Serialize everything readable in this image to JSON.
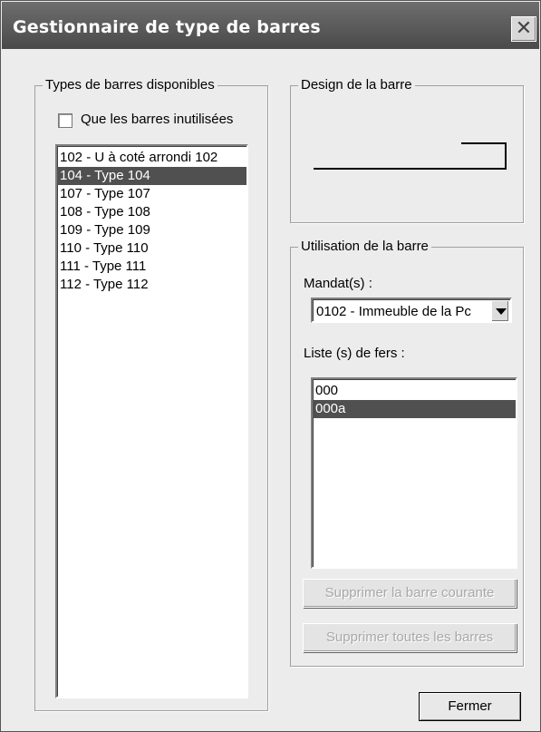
{
  "window": {
    "title": "Gestionnaire de type de barres",
    "close_icon": "close-icon"
  },
  "left_group": {
    "legend": "Types de barres disponibles",
    "checkbox_label": "Que les barres inutilisées",
    "checkbox_checked": false,
    "items": [
      "102 - U à coté arrondi 102",
      "104 - Type 104",
      "107 - Type 107",
      "108 - Type 108",
      "109 - Type 109",
      "110 - Type 110",
      "111 - Type 111",
      "112 - Type 112"
    ],
    "selected_index": 1
  },
  "design_group": {
    "legend": "Design de la barre"
  },
  "usage_group": {
    "legend": "Utilisation de la barre",
    "mandat_label": "Mandat(s) :",
    "mandat_value": "0102 - Immeuble de la Pc",
    "liste_label": "Liste (s) de fers :",
    "liste_items": [
      "000",
      "000a"
    ],
    "liste_selected_index": 1,
    "btn_delete_current": "Supprimer la barre courante",
    "btn_delete_all": "Supprimer toutes les barres"
  },
  "footer": {
    "close_button": "Fermer"
  }
}
